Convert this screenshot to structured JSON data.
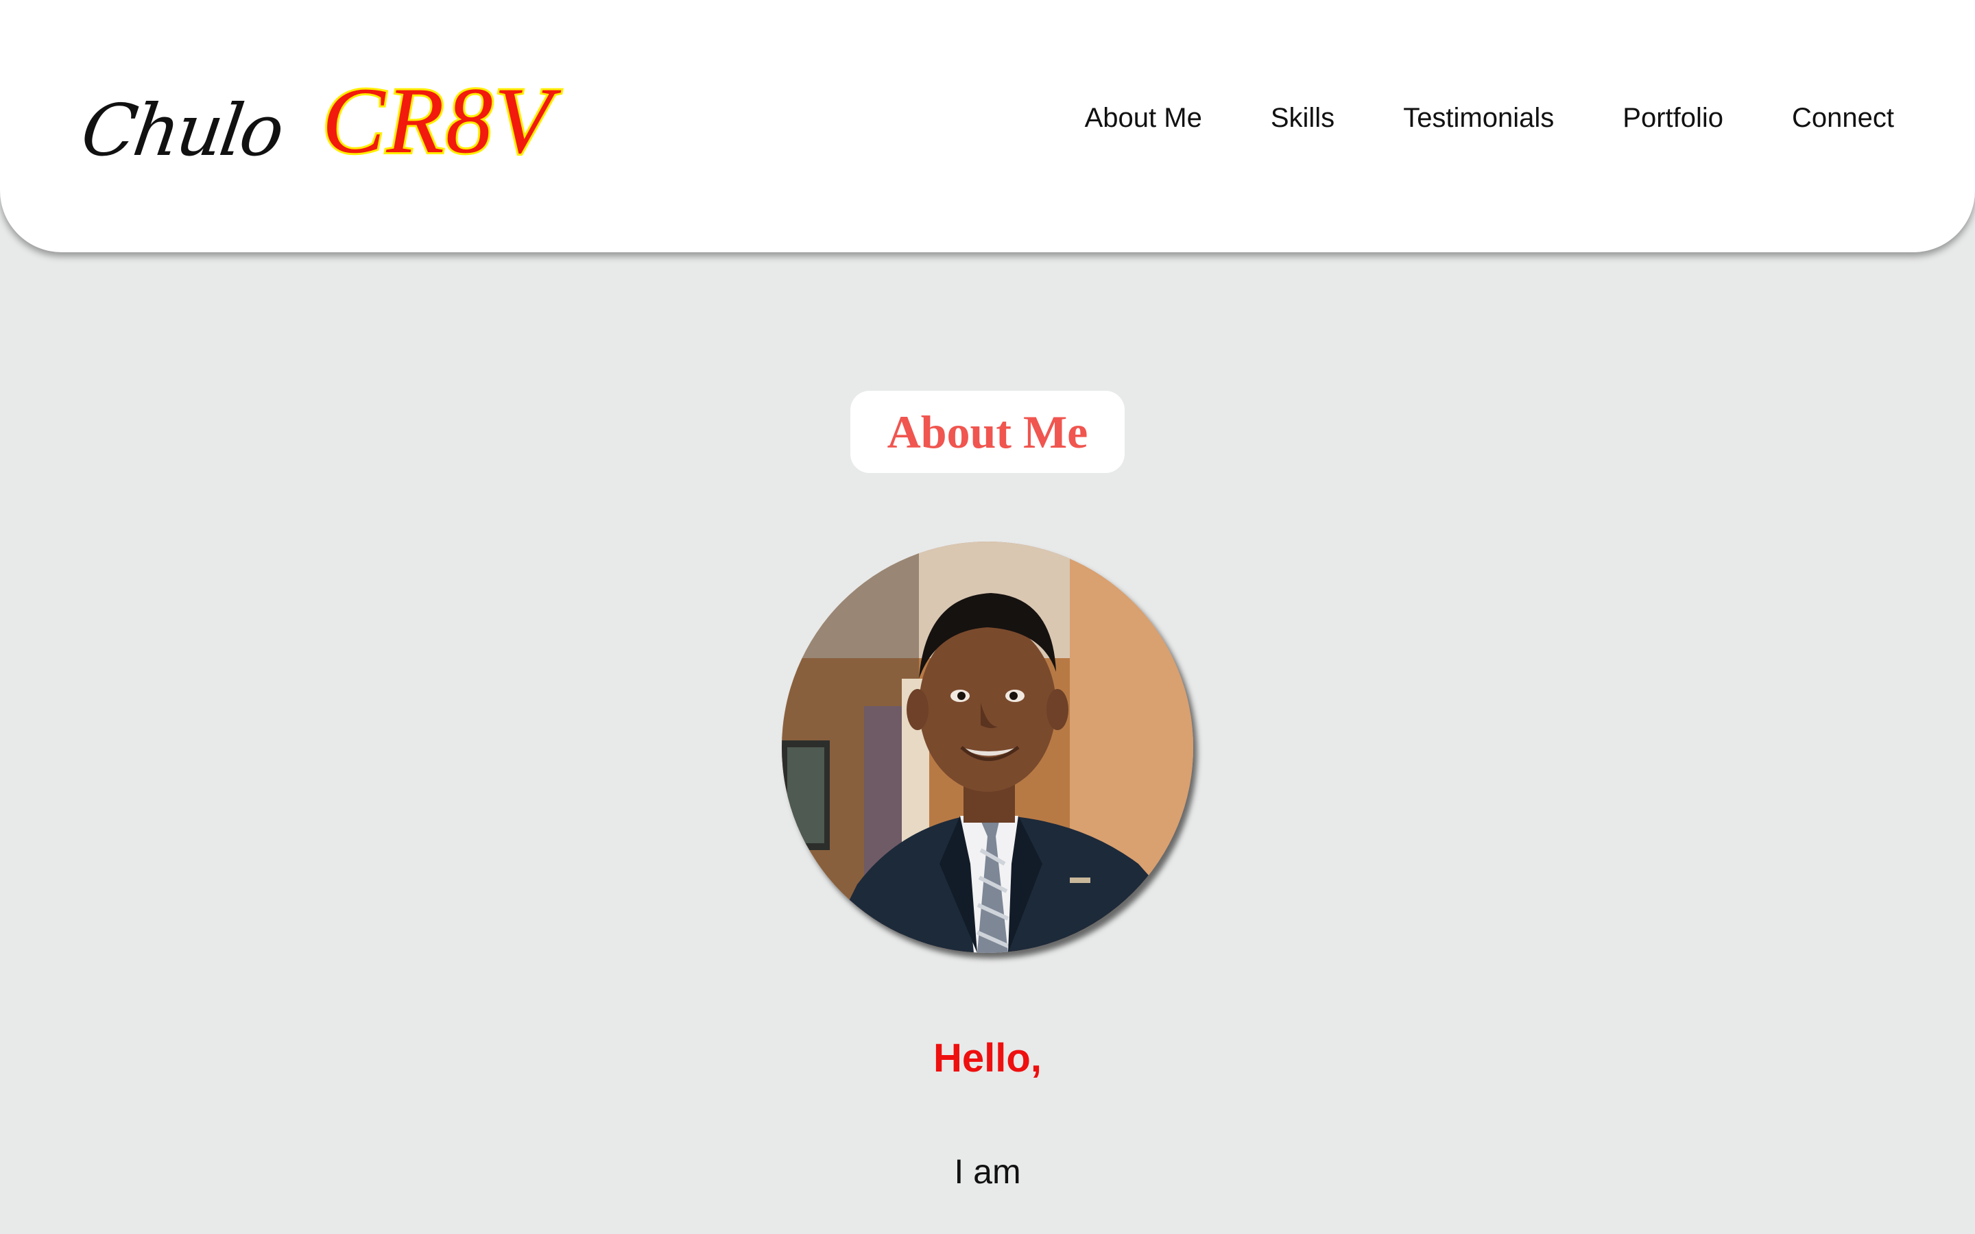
{
  "header": {
    "logo_script": "Chulo",
    "logo_brand": "CR8V",
    "nav": [
      {
        "label": "About Me"
      },
      {
        "label": "Skills"
      },
      {
        "label": "Testimonials"
      },
      {
        "label": "Portfolio"
      },
      {
        "label": "Connect"
      }
    ]
  },
  "about": {
    "section_title": "About Me",
    "avatar_alt": "profile-photo",
    "greeting": "Hello,",
    "intro": "I am"
  },
  "colors": {
    "background": "#e8e9e9",
    "header_bg": "#ffffff",
    "brand_red": "#f11a0c",
    "brand_outline": "#ffee00",
    "title_red": "#f0554f",
    "greeting_red": "#ee0f0f"
  }
}
